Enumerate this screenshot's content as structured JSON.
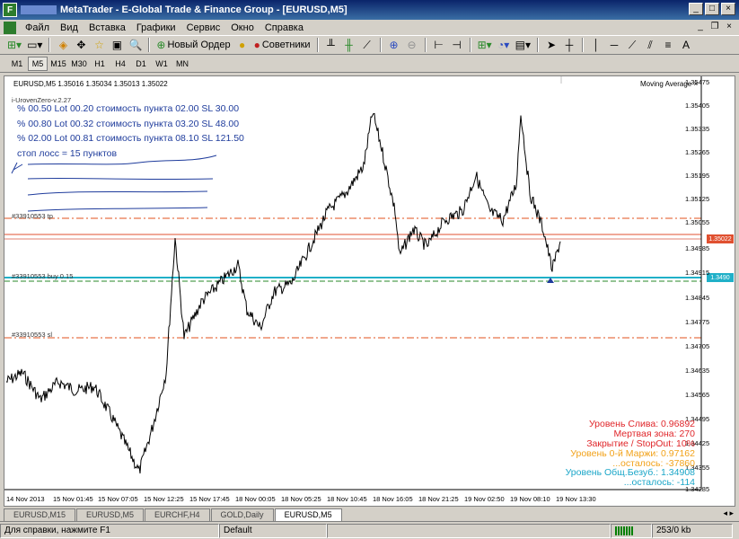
{
  "window": {
    "title": "MetaTrader - E-Global Trade & Finance Group - [EURUSD,M5]"
  },
  "menu": [
    "Файл",
    "Вид",
    "Вставка",
    "Графики",
    "Сервис",
    "Окно",
    "Справка"
  ],
  "toolbar": {
    "new_order": "Новый Ордер",
    "advisors": "Советники"
  },
  "timeframes": [
    "M1",
    "M5",
    "M15",
    "M30",
    "H1",
    "H4",
    "D1",
    "W1",
    "MN"
  ],
  "active_timeframe": "M5",
  "chart": {
    "symbol_line": "EURUSD,M5  1.35016 1.35034 1.35013 1.35022",
    "indicator_label": "Moving Average",
    "indicator_name": "i-UrovenZero-v.2.27",
    "info_lines": [
      "% 00.50  Lot 00.20  стоимость пункта 02.00  SL 30.00",
      "% 00.80  Lot 00.32  стоимость пункта 03.20  SL 48.00",
      "% 02.00  Lot 00.81  стоимость пункта 08.10  SL 121.50",
      "стоп лосс = 15 пунктов"
    ],
    "level_tags": {
      "tp": "#33910553 tp",
      "buy": "#33910553 buy 0.15",
      "sl": "#33910553 sl"
    },
    "current_price": "1.35022",
    "buy_price": "1.3490",
    "y_axis": [
      "1.35475",
      "1.35405",
      "1.35335",
      "1.35265",
      "1.35195",
      "1.35125",
      "1.35055",
      "1.34985",
      "1.34915",
      "1.34845",
      "1.34775",
      "1.34705",
      "1.34635",
      "1.34565",
      "1.34495",
      "1.34425",
      "1.34355",
      "1.34285"
    ],
    "x_axis": [
      "14 Nov 2013",
      "15 Nov 01:45",
      "15 Nov 07:05",
      "15 Nov 12:25",
      "15 Nov 17:45",
      "18 Nov 00:05",
      "18 Nov 05:25",
      "18 Nov 10:45",
      "18 Nov 16:05",
      "18 Nov 21:25",
      "19 Nov 02:50",
      "19 Nov 08:10",
      "19 Nov 13:30"
    ],
    "status": {
      "drain_level": "Уровень Слива: 0.96892",
      "dead_zone": "Мертвая зона:    270",
      "close_stopout": "Закрытие / StopOut:    10%",
      "margin_level": "Уровень 0-й Маржи: 0.97162",
      "margin_left": "...осталось:   -37860",
      "breakeven_level": "Уровень Общ.Безуб.: 1.34908",
      "breakeven_left": "...осталось:    -114"
    },
    "colors": {
      "drain": "#e0262a",
      "margin": "#f2a21a",
      "breakeven": "#1aa6c8",
      "info": "#1f3c9c",
      "tp_sl_line": "#e0501e",
      "buy_line": "#20b0c8"
    }
  },
  "tabs": [
    "EURUSD,M15",
    "EURUSD,M5",
    "EURCHF,H4",
    "GOLD,Daily",
    "EURUSD,M5"
  ],
  "active_tab": 4,
  "statusbar": {
    "help": "Для справки, нажмите F1",
    "profile": "Default",
    "traffic": "253/0 kb"
  }
}
